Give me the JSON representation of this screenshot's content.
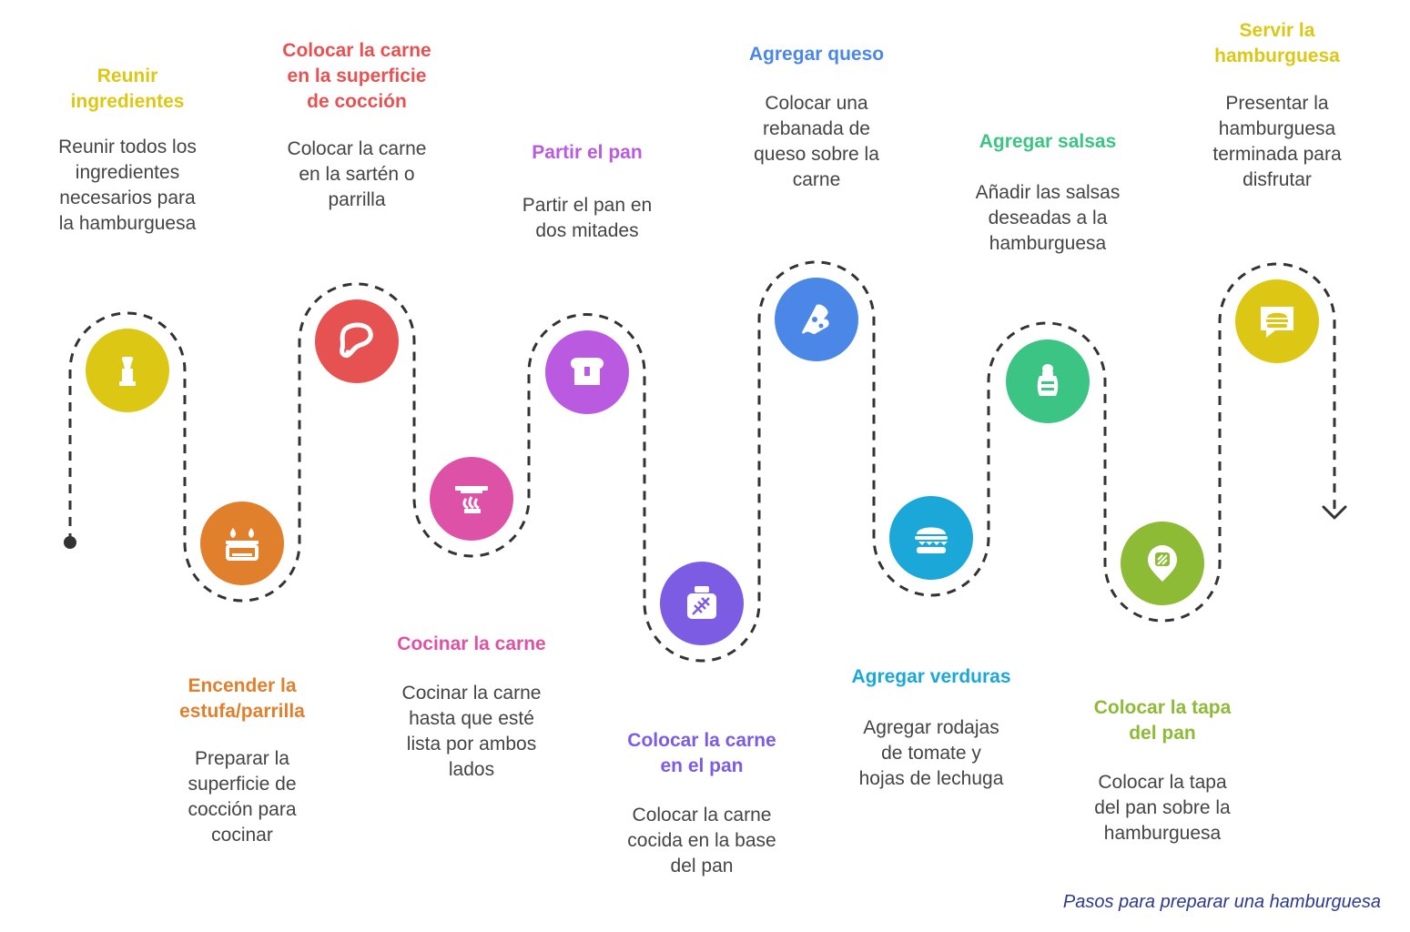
{
  "steps": [
    {
      "title_lines": [
        "Reunir",
        "ingredientes"
      ],
      "desc_lines": [
        "Reunir todos los",
        "ingredientes",
        "necesarios para",
        "la hamburguesa"
      ],
      "color": "#dcc814",
      "icon": "pepper-shaker-icon"
    },
    {
      "title_lines": [
        "Encender la",
        "estufa/parrilla"
      ],
      "desc_lines": [
        "Preparar la",
        "superficie de",
        "cocción para",
        "cocinar"
      ],
      "color": "#e07f2c",
      "icon": "gas-stove-icon"
    },
    {
      "title_lines": [
        "Colocar la carne",
        "en la superficie",
        "de cocción"
      ],
      "desc_lines": [
        "Colocar la carne",
        "en la sartén o",
        "parrilla"
      ],
      "color": "#e65252",
      "icon": "meat-steak-icon"
    },
    {
      "title_lines": [
        "Cocinar la carne"
      ],
      "desc_lines": [
        "Cocinar la carne",
        "hasta que esté",
        "lista por ambos",
        "lados"
      ],
      "color": "#dd52a6",
      "icon": "frying-pan-icon"
    },
    {
      "title_lines": [
        "Partir el pan"
      ],
      "desc_lines": [
        "Partir el pan en",
        "dos mitades"
      ],
      "color": "#b95ae0",
      "icon": "bread-icon"
    },
    {
      "title_lines": [
        "Colocar la carne",
        "en el pan"
      ],
      "desc_lines": [
        "Colocar la carne",
        "cocida en la base",
        "del pan"
      ],
      "color": "#7c5ce3",
      "icon": "spice-jar-icon"
    },
    {
      "title_lines": [
        "Agregar queso"
      ],
      "desc_lines": [
        "Colocar una",
        "rebanada de",
        "queso sobre la",
        "carne"
      ],
      "color": "#4b87e6",
      "icon": "cheese-slice-icon"
    },
    {
      "title_lines": [
        "Agregar verduras"
      ],
      "desc_lines": [
        "Agregar rodajas",
        "de tomate y",
        "hojas de lechuga"
      ],
      "color": "#1ba8d8",
      "icon": "burger-icon"
    },
    {
      "title_lines": [
        "Agregar salsas"
      ],
      "desc_lines": [
        "Añadir las salsas",
        "deseadas a la",
        "hamburguesa"
      ],
      "color": "#3cc484",
      "icon": "salt-shaker-icon"
    },
    {
      "title_lines": [
        "Colocar la tapa",
        "del pan"
      ],
      "desc_lines": [
        "Colocar la tapa",
        "del pan sobre la",
        "hamburguesa"
      ],
      "color": "#8dbb35",
      "icon": "toast-pin-icon"
    },
    {
      "title_lines": [
        "Servir la",
        "hamburguesa"
      ],
      "desc_lines": [
        "Presentar la",
        "hamburguesa",
        "terminada para",
        "disfrutar"
      ],
      "color": "#dcc814",
      "icon": "burger-message-icon"
    }
  ],
  "caption": "Pasos para preparar una hamburguesa",
  "colors": {
    "path": "#333333",
    "description_text": "#444444",
    "caption": "#2d3a8c"
  }
}
